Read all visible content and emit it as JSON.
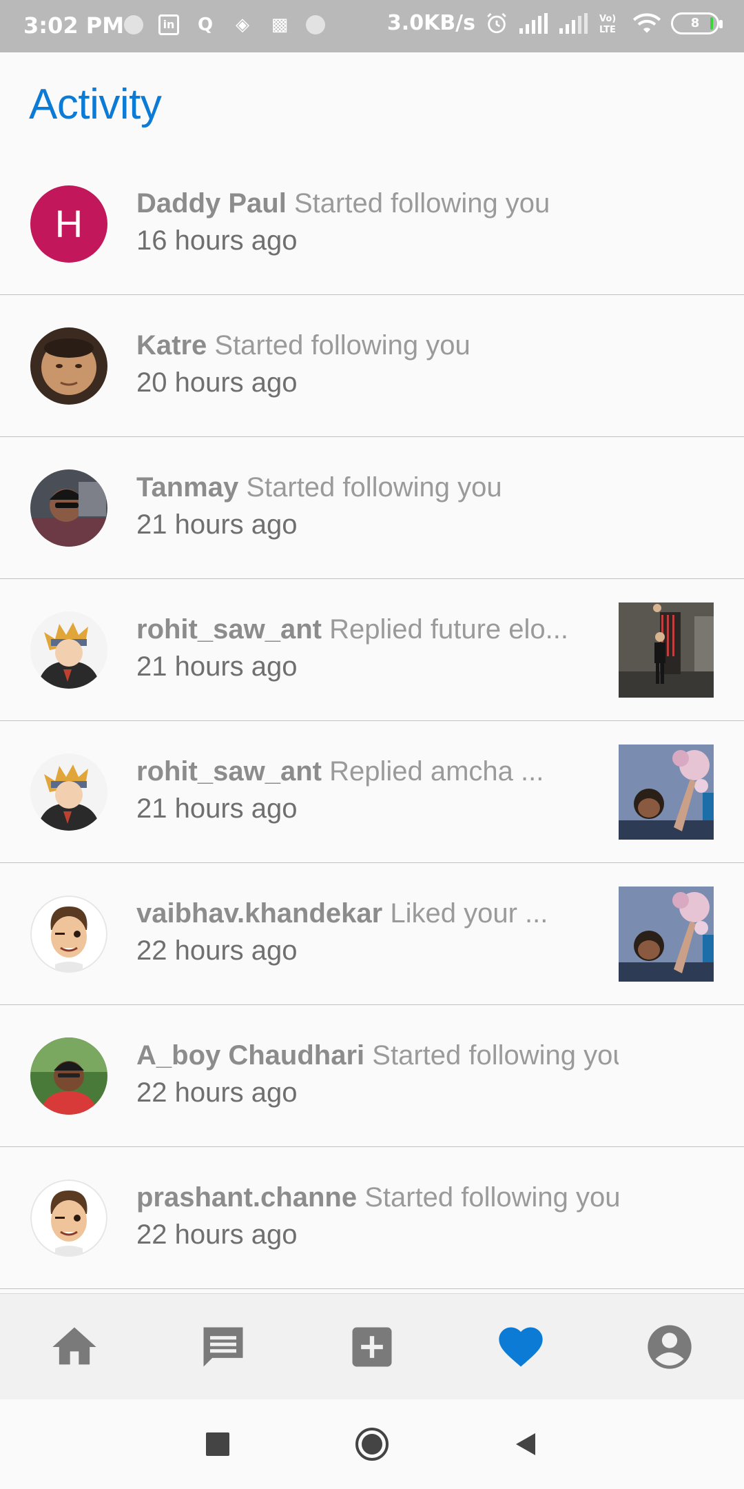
{
  "status_bar": {
    "time": "3:02 PM",
    "speed": "3.0KB/s",
    "battery": "8"
  },
  "header": {
    "title": "Activity"
  },
  "activity": [
    {
      "username": "Daddy Paul",
      "action": "Started following you",
      "time": "16 hours ago",
      "avatar": "letter-avatar",
      "avatar_letter": "H",
      "thumb": null
    },
    {
      "username": "Katre",
      "action": "Started following you",
      "time": "20 hours ago",
      "avatar": "photo-avatar",
      "thumb": null
    },
    {
      "username": "Tanmay",
      "action": "Started following you",
      "time": "21 hours ago",
      "avatar": "photo-avatar",
      "thumb": null
    },
    {
      "username": "rohit_saw_ant",
      "action": "Replied future elo...",
      "time": "21 hours ago",
      "avatar": "anime-avatar",
      "thumb": "post-thumbnail"
    },
    {
      "username": "rohit_saw_ant",
      "action": "Replied amcha ...",
      "time": "21 hours ago",
      "avatar": "anime-avatar",
      "thumb": "post-thumbnail"
    },
    {
      "username": "vaibhav.khandekar",
      "action": "Liked your ...",
      "time": "22 hours ago",
      "avatar": "cartoon-avatar",
      "thumb": "post-thumbnail"
    },
    {
      "username": "A_boy Chaudhari",
      "action": "Started following you",
      "time": "22 hours ago",
      "avatar": "photo-avatar",
      "thumb": null
    },
    {
      "username": "prashant.channe",
      "action": "Started following you",
      "time": "22 hours ago",
      "avatar": "cartoon-avatar",
      "thumb": null
    }
  ],
  "bottom_nav": [
    {
      "icon": "home-icon",
      "active": false
    },
    {
      "icon": "chat-icon",
      "active": false
    },
    {
      "icon": "add-post-icon",
      "active": false
    },
    {
      "icon": "heart-icon",
      "active": true
    },
    {
      "icon": "profile-icon",
      "active": false
    }
  ],
  "colors": {
    "accent": "#0c7bd6",
    "inactive_icon": "#7a7a7a",
    "letter_avatar": "#c2185b"
  }
}
